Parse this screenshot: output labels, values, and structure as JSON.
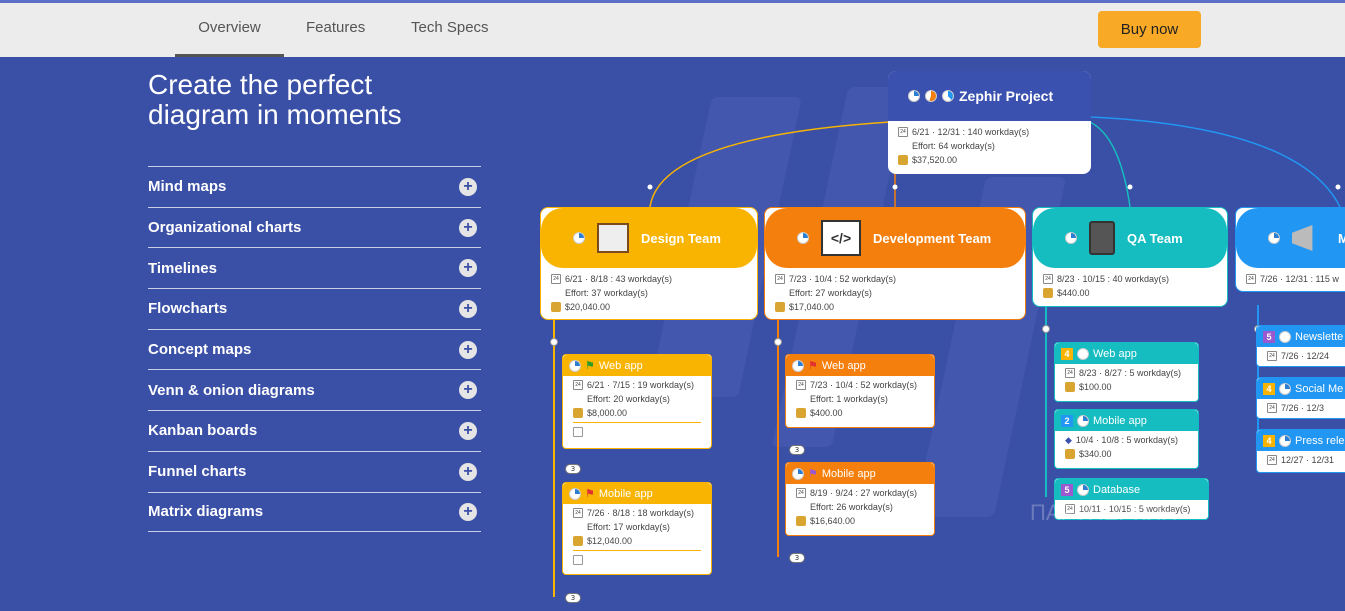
{
  "nav": {
    "tabs": [
      "Overview",
      "Features",
      "Tech Specs"
    ],
    "buy_label": "Buy now"
  },
  "hero": {
    "title_line1": "Create the perfect",
    "title_line2": "diagram in moments"
  },
  "accordion": [
    "Mind maps",
    "Organizational charts",
    "Timelines",
    "Flowcharts",
    "Concept maps",
    "Venn & onion diagrams",
    "Kanban boards",
    "Funnel charts",
    "Matrix diagrams"
  ],
  "diagram": {
    "root": {
      "title": "Zephir Project",
      "dates": "6/21 · 12/31 : 140 workday(s)",
      "effort": "Effort: 64 workday(s)",
      "cost": "$37,520.00"
    },
    "teams": [
      {
        "title": "Design Team",
        "dates": "6/21 · 8/18 : 43 workday(s)",
        "effort": "Effort: 37 workday(s)",
        "cost": "$20,040.00",
        "color": "#f8b400"
      },
      {
        "title": "Development Team",
        "dates": "7/23 · 10/4 : 52 workday(s)",
        "effort": "Effort: 27 workday(s)",
        "cost": "$17,040.00",
        "color": "#f57f0c"
      },
      {
        "title": "QA Team",
        "dates": "8/23 · 10/15 : 40 workday(s)",
        "cost": "$440.00",
        "color": "#15bcc0"
      },
      {
        "title": "M",
        "dates": "7/26 · 12/31 : 115 w",
        "color": "#2196f3"
      }
    ],
    "design_tasks": [
      {
        "title": "Web app",
        "dates": "6/21 · 7/15 : 19 workday(s)",
        "effort": "Effort: 20 workday(s)",
        "cost": "$8,000.00",
        "badge": "3"
      },
      {
        "title": "Mobile app",
        "dates": "7/26 · 8/18 : 18 workday(s)",
        "effort": "Effort: 17 workday(s)",
        "cost": "$12,040.00",
        "badge": "3"
      }
    ],
    "dev_tasks": [
      {
        "title": "Web app",
        "dates": "7/23 · 10/4 : 52 workday(s)",
        "effort": "Effort: 1 workday(s)",
        "cost": "$400.00",
        "badge": "3"
      },
      {
        "title": "Mobile app",
        "dates": "8/19 · 9/24 : 27 workday(s)",
        "effort": "Effort: 26 workday(s)",
        "cost": "$16,640.00",
        "badge": "3"
      }
    ],
    "qa_tasks": [
      {
        "num": "4",
        "title": "Web app",
        "dates": "8/23 · 8/27 : 5 workday(s)",
        "cost": "$100.00"
      },
      {
        "num": "2",
        "title": "Mobile app",
        "dates": "10/4 · 10/8 : 5 workday(s)",
        "cost": "$340.00"
      },
      {
        "num": "5",
        "title": "Database",
        "dates": "10/11 · 10/15 : 5 workday(s)"
      }
    ],
    "m_tasks": [
      {
        "num": "5",
        "title": "Newslette",
        "dates": "7/26 · 12/24"
      },
      {
        "num": "4",
        "title": "Social Me",
        "dates": "7/26 · 12/3"
      },
      {
        "num": "4",
        "title": "Press relea",
        "dates": "12/27 · 12/31"
      }
    ]
  },
  "watermark": "ПАРТНЕРКИН"
}
